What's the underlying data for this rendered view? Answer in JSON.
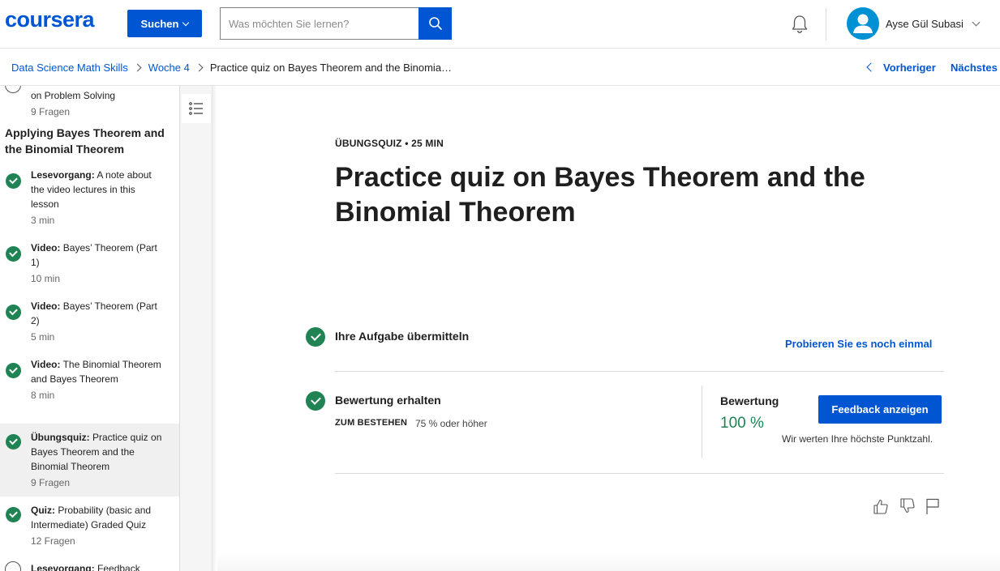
{
  "header": {
    "logo": "coursera",
    "search_button_label": "Suchen",
    "search_placeholder": "Was möchten Sie lernen?",
    "user_name": "Ayse Gül Subasi"
  },
  "breadcrumb": {
    "items": [
      "Data Science Math Skills",
      "Woche 4"
    ],
    "current": "Practice quiz on Bayes Theorem and the Binomia…",
    "prev_label": "Vorheriger",
    "next_label": "Nächstes"
  },
  "sidebar": {
    "top_item": {
      "title": "on Problem Solving",
      "meta": "9 Fragen"
    },
    "section_title": "Applying Bayes Theorem and the Binomial Theorem",
    "items": [
      {
        "kind": "Lesevorgang:",
        "title": " A note about the video lectures in this lesson",
        "meta": "3 min",
        "status": "completed"
      },
      {
        "kind": "Video:",
        "title": " Bayes’ Theorem (Part 1)",
        "meta": "10 min",
        "status": "completed"
      },
      {
        "kind": "Video:",
        "title": " Bayes’ Theorem (Part 2)",
        "meta": "5 min",
        "status": "completed"
      },
      {
        "kind": "Video:",
        "title": " The Binomial Theorem and Bayes Theorem",
        "meta": "8 min",
        "status": "completed"
      },
      {
        "kind": "Übungsquiz:",
        "title": " Practice quiz on Bayes Theorem and the Binomial Theorem",
        "meta": "9 Fragen",
        "status": "completed",
        "active": true
      },
      {
        "kind": "Quiz:",
        "title": " Probability (basic and Intermediate) Graded Quiz",
        "meta": "12 Fragen",
        "status": "completed"
      },
      {
        "kind": "Lesevorgang:",
        "title": " Feedback",
        "meta": "",
        "status": "not-started"
      }
    ]
  },
  "main": {
    "eyebrow": "ÜBUNGSQUIZ • 25 MIN",
    "title": "Practice quiz on Bayes Theorem and the Binomial Theorem",
    "step1_title": "Ihre Aufgabe übermitteln",
    "retry_label": "Probieren Sie es noch einmal",
    "step2_title": "Bewertung erhalten",
    "pass_label": "ZUM BESTEHEN",
    "pass_value": "75 % oder höher",
    "grade_label": "Bewertung",
    "grade_value": "100 %",
    "feedback_button": "Feedback anzeigen",
    "grade_note": "Wir werten Ihre höchste Punktzahl."
  },
  "icons": {
    "search": "search-icon",
    "bell": "bell-icon",
    "avatar": "user-avatar-icon",
    "outline": "list-outline-icon",
    "like": "thumbs-up-icon",
    "dislike": "thumbs-down-icon",
    "flag": "flag-icon"
  },
  "colors": {
    "brand": "#0056d2",
    "success": "#1f8354",
    "avatar": "#0091d5"
  }
}
